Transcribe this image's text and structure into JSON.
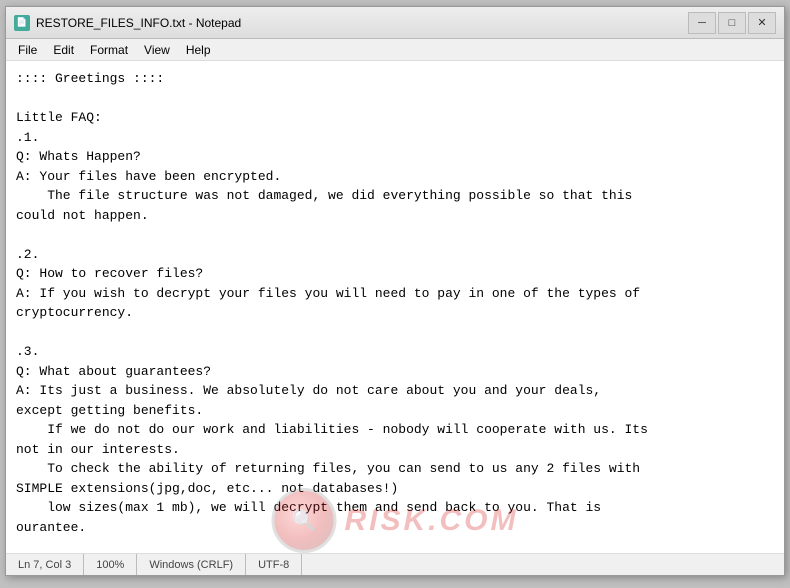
{
  "window": {
    "title": "RESTORE_FILES_INFO.txt - Notepad",
    "icon_label": "N"
  },
  "title_controls": {
    "minimize": "─",
    "maximize": "□",
    "close": "✕"
  },
  "menu": {
    "items": [
      "File",
      "Edit",
      "Format",
      "View",
      "Help"
    ]
  },
  "content": {
    "text": ":::: Greetings ::::\n\nLittle FAQ:\n.1.\nQ: Whats Happen?\nA: Your files have been encrypted.\n    The file structure was not damaged, we did everything possible so that this\ncould not happen.\n\n.2.\nQ: How to recover files?\nA: If you wish to decrypt your files you will need to pay in one of the types of\ncryptocurrency.\n\n.3.\nQ: What about guarantees?\nA: Its just a business. We absolutely do not care about you and your deals,\nexcept getting benefits.\n    If we do not do our work and liabilities - nobody will cooperate with us. Its\nnot in our interests.\n    To check the ability of returning files, you can send to us any 2 files with\nSIMPLE extensions(jpg,doc, etc... not databases!)\n    low sizes(max 1 mb), we will decrypt them and send back to you. That is\nourantee."
  },
  "status_bar": {
    "position": "Ln 7, Col 3",
    "col": "3",
    "zoom": "100%",
    "line_ending": "Windows (CRLF)",
    "encoding": "UTF-8"
  }
}
